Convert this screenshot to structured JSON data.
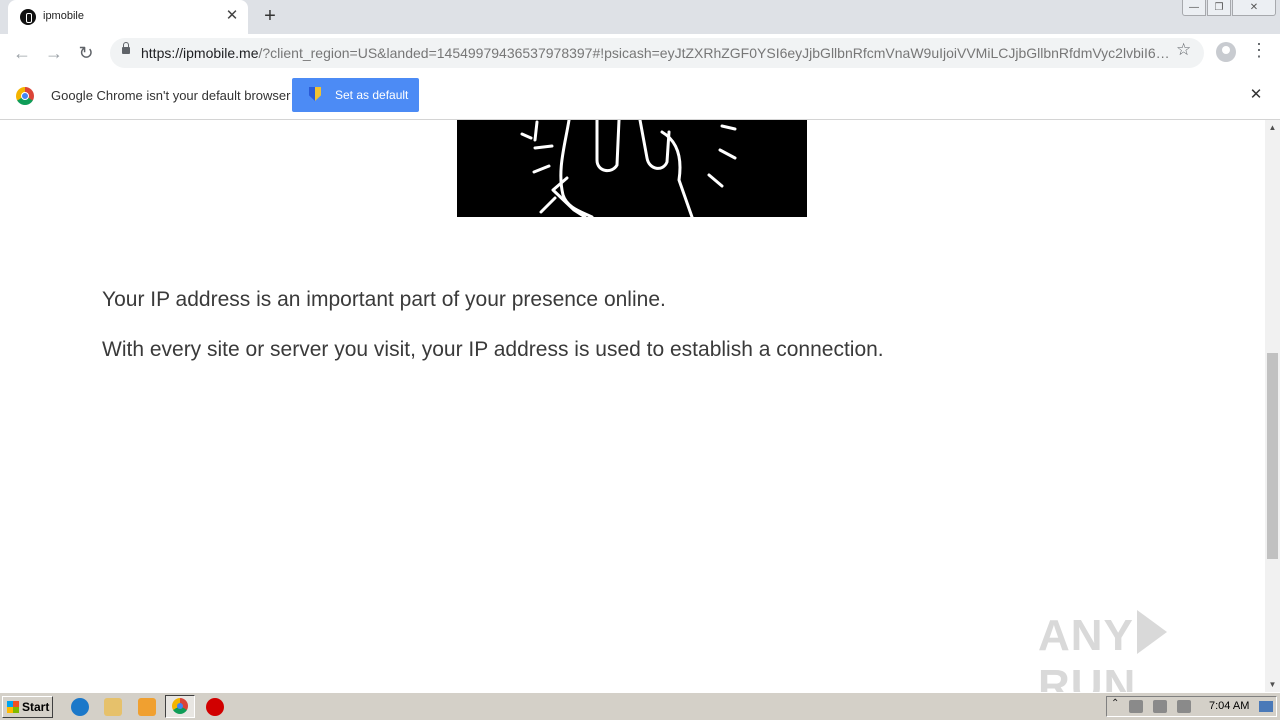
{
  "tab": {
    "title": "ipmobile",
    "close": "✕"
  },
  "new_tab": "+",
  "window_controls": {
    "minimize": "—",
    "maximize": "❐",
    "close": "✕"
  },
  "toolbar": {
    "back": "←",
    "forward": "→",
    "reload": "↻",
    "url_host": "https://ipmobile.me",
    "url_rest": "/?client_region=US&landed=14549979436537978397#!psicash=eyJtZXRhZGF0YSI6eyJjbGllbnRfcmVnaW9uIjoiVVMiLCJjbGllbnRfdmVyc2lvbiI6IjE...",
    "star": "☆",
    "menu": "⋮"
  },
  "infobar": {
    "message": "Google Chrome isn't your default browser",
    "button": "Set as default",
    "close": "✕"
  },
  "content": {
    "paragraph1": "Your IP address is an important part of your presence online.",
    "paragraph2": "With every site or server you visit, your IP address is used to establish a connection."
  },
  "watermark": {
    "left": "ANY",
    "right": "RUN"
  },
  "scrollbar": {
    "up": "▲",
    "down": "▼",
    "position": 0.41
  },
  "taskbar": {
    "start": "Start",
    "tray_up": "⌃",
    "clock": "7:04 AM"
  },
  "icons": {
    "tab_favicon": "ipmobile-favicon-icon",
    "infobar_logo": "chrome-logo-icon",
    "button_shield": "windows-shield-icon"
  }
}
